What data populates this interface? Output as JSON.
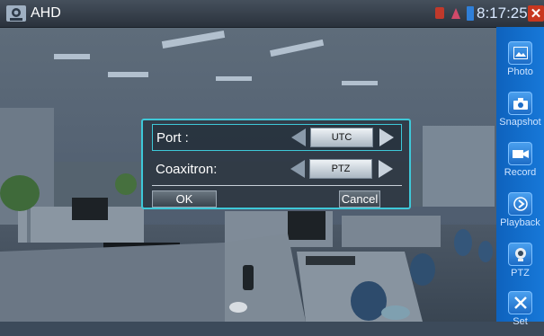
{
  "app": {
    "title": "AHD",
    "time": "8:17:25"
  },
  "sidebar": {
    "items": [
      {
        "label": "Photo",
        "icon": "photo-icon"
      },
      {
        "label": "Snapshot",
        "icon": "camera-icon"
      },
      {
        "label": "Record",
        "icon": "record-icon"
      },
      {
        "label": "Playback",
        "icon": "playback-icon"
      },
      {
        "label": "PTZ",
        "icon": "ptz-camera-icon"
      },
      {
        "label": "Set",
        "icon": "tools-icon"
      }
    ]
  },
  "dialog": {
    "port_label": "Port :",
    "port_value": "UTC",
    "coaxitron_label": "Coaxitron:",
    "coaxitron_value": "PTZ",
    "ok_label": "OK",
    "cancel_label": "Cancel"
  },
  "colors": {
    "accent": "#3ec8d8",
    "sidebar": "#1670d0",
    "close": "#c8371f"
  }
}
